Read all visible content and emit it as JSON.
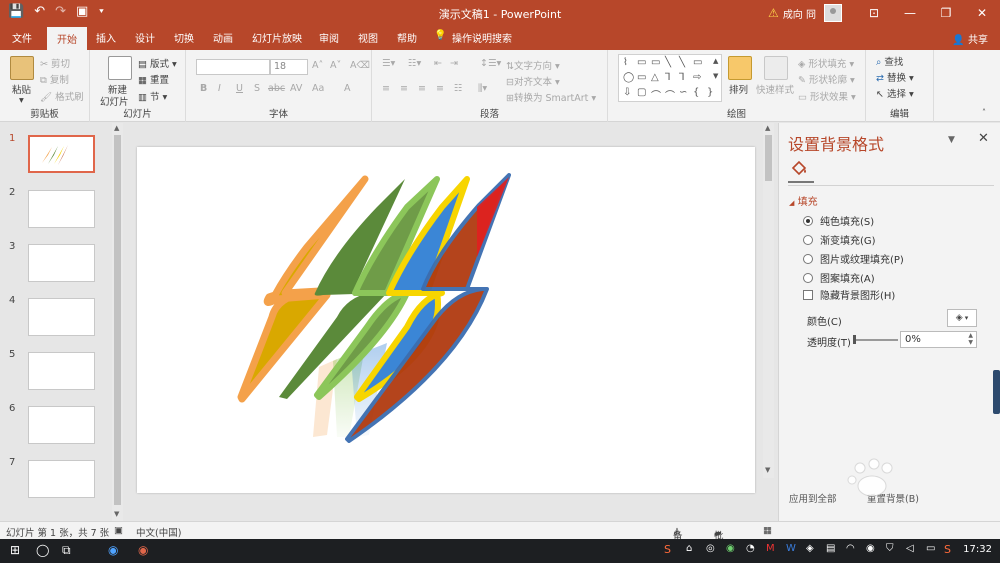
{
  "window": {
    "title": "演示文稿1 - PowerPoint",
    "user": "成向 冏",
    "warn_icon": "warning-icon"
  },
  "tabs": [
    "文件",
    "开始",
    "插入",
    "设计",
    "切换",
    "动画",
    "幻灯片放映",
    "审阅",
    "视图",
    "帮助",
    "操作说明搜索"
  ],
  "share": "共享",
  "ribbon": {
    "clipboard": {
      "paste": "粘贴",
      "cut": "剪切",
      "copy": "复制",
      "format_painter": "格式刷",
      "label": "剪贴板"
    },
    "slides": {
      "new_slide_1": "新建",
      "new_slide_2": "幻灯片",
      "layout": "版式",
      "reset": "重置",
      "section": "节",
      "label": "幻灯片"
    },
    "font": {
      "size": "18",
      "label": "字体",
      "buttons": [
        "B",
        "I",
        "U",
        "S",
        "abc",
        "AV",
        "Aa",
        "A"
      ]
    },
    "paragraph": {
      "text_direction": "文字方向",
      "align_text": "对齐文本",
      "smartart": "转换为 SmartArt",
      "label": "段落"
    },
    "drawing": {
      "arrange": "排列",
      "quick_styles": "快速样式",
      "shape_fill": "形状填充",
      "shape_outline": "形状轮廓",
      "shape_effects": "形状效果",
      "label": "绘图"
    },
    "editing": {
      "find": "查找",
      "replace": "替换",
      "select": "选择",
      "label": "编辑"
    }
  },
  "thumbnails": [
    "1",
    "2",
    "3",
    "4",
    "5",
    "6",
    "7"
  ],
  "pane": {
    "title": "设置背景格式",
    "section": "填充",
    "options": [
      {
        "label": "纯色填充(S)",
        "checked": true
      },
      {
        "label": "渐变填充(G)",
        "checked": false
      },
      {
        "label": "图片或纹理填充(P)",
        "checked": false
      },
      {
        "label": "图案填充(A)",
        "checked": false
      }
    ],
    "hide_bg": "隐藏背景图形(H)",
    "color_label": "颜色(C)",
    "transparency_label": "透明度(T)",
    "transparency_value": "0%",
    "apply_all": "应用到全部",
    "reset_bg": "重置背景(B)"
  },
  "status": {
    "slide_info": "幻灯片 第 1 张，共 7 张",
    "language": "中文(中国)",
    "notes": "备注",
    "comments": "批注"
  },
  "taskbar": {
    "time": "17:32"
  },
  "colors": {
    "accent": "#b7472a",
    "shape_orange": "#f4a14a",
    "shape_gold": "#d9a800",
    "shape_green_dark": "#5b8a3a",
    "shape_green": "#8cc65a",
    "shape_yellow": "#f7d500",
    "shape_blue": "#3b86d6",
    "shape_red": "#e02020",
    "shape_brown": "#b03a10"
  }
}
